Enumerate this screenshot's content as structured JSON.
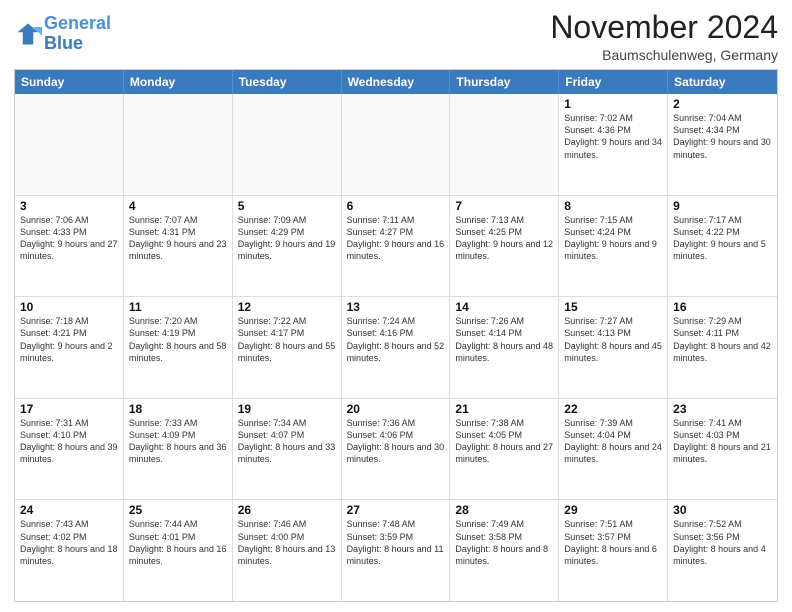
{
  "header": {
    "logo_general": "General",
    "logo_blue": "Blue",
    "month_title": "November 2024",
    "location": "Baumschulenweg, Germany"
  },
  "days_of_week": [
    "Sunday",
    "Monday",
    "Tuesday",
    "Wednesday",
    "Thursday",
    "Friday",
    "Saturday"
  ],
  "weeks": [
    {
      "cells": [
        {
          "day": "",
          "info": "",
          "empty": true
        },
        {
          "day": "",
          "info": "",
          "empty": true
        },
        {
          "day": "",
          "info": "",
          "empty": true
        },
        {
          "day": "",
          "info": "",
          "empty": true
        },
        {
          "day": "",
          "info": "",
          "empty": true
        },
        {
          "day": "1",
          "info": "Sunrise: 7:02 AM\nSunset: 4:36 PM\nDaylight: 9 hours and 34 minutes.",
          "empty": false
        },
        {
          "day": "2",
          "info": "Sunrise: 7:04 AM\nSunset: 4:34 PM\nDaylight: 9 hours and 30 minutes.",
          "empty": false
        }
      ]
    },
    {
      "cells": [
        {
          "day": "3",
          "info": "Sunrise: 7:06 AM\nSunset: 4:33 PM\nDaylight: 9 hours and 27 minutes.",
          "empty": false
        },
        {
          "day": "4",
          "info": "Sunrise: 7:07 AM\nSunset: 4:31 PM\nDaylight: 9 hours and 23 minutes.",
          "empty": false
        },
        {
          "day": "5",
          "info": "Sunrise: 7:09 AM\nSunset: 4:29 PM\nDaylight: 9 hours and 19 minutes.",
          "empty": false
        },
        {
          "day": "6",
          "info": "Sunrise: 7:11 AM\nSunset: 4:27 PM\nDaylight: 9 hours and 16 minutes.",
          "empty": false
        },
        {
          "day": "7",
          "info": "Sunrise: 7:13 AM\nSunset: 4:25 PM\nDaylight: 9 hours and 12 minutes.",
          "empty": false
        },
        {
          "day": "8",
          "info": "Sunrise: 7:15 AM\nSunset: 4:24 PM\nDaylight: 9 hours and 9 minutes.",
          "empty": false
        },
        {
          "day": "9",
          "info": "Sunrise: 7:17 AM\nSunset: 4:22 PM\nDaylight: 9 hours and 5 minutes.",
          "empty": false
        }
      ]
    },
    {
      "cells": [
        {
          "day": "10",
          "info": "Sunrise: 7:18 AM\nSunset: 4:21 PM\nDaylight: 9 hours and 2 minutes.",
          "empty": false
        },
        {
          "day": "11",
          "info": "Sunrise: 7:20 AM\nSunset: 4:19 PM\nDaylight: 8 hours and 58 minutes.",
          "empty": false
        },
        {
          "day": "12",
          "info": "Sunrise: 7:22 AM\nSunset: 4:17 PM\nDaylight: 8 hours and 55 minutes.",
          "empty": false
        },
        {
          "day": "13",
          "info": "Sunrise: 7:24 AM\nSunset: 4:16 PM\nDaylight: 8 hours and 52 minutes.",
          "empty": false
        },
        {
          "day": "14",
          "info": "Sunrise: 7:26 AM\nSunset: 4:14 PM\nDaylight: 8 hours and 48 minutes.",
          "empty": false
        },
        {
          "day": "15",
          "info": "Sunrise: 7:27 AM\nSunset: 4:13 PM\nDaylight: 8 hours and 45 minutes.",
          "empty": false
        },
        {
          "day": "16",
          "info": "Sunrise: 7:29 AM\nSunset: 4:11 PM\nDaylight: 8 hours and 42 minutes.",
          "empty": false
        }
      ]
    },
    {
      "cells": [
        {
          "day": "17",
          "info": "Sunrise: 7:31 AM\nSunset: 4:10 PM\nDaylight: 8 hours and 39 minutes.",
          "empty": false
        },
        {
          "day": "18",
          "info": "Sunrise: 7:33 AM\nSunset: 4:09 PM\nDaylight: 8 hours and 36 minutes.",
          "empty": false
        },
        {
          "day": "19",
          "info": "Sunrise: 7:34 AM\nSunset: 4:07 PM\nDaylight: 8 hours and 33 minutes.",
          "empty": false
        },
        {
          "day": "20",
          "info": "Sunrise: 7:36 AM\nSunset: 4:06 PM\nDaylight: 8 hours and 30 minutes.",
          "empty": false
        },
        {
          "day": "21",
          "info": "Sunrise: 7:38 AM\nSunset: 4:05 PM\nDaylight: 8 hours and 27 minutes.",
          "empty": false
        },
        {
          "day": "22",
          "info": "Sunrise: 7:39 AM\nSunset: 4:04 PM\nDaylight: 8 hours and 24 minutes.",
          "empty": false
        },
        {
          "day": "23",
          "info": "Sunrise: 7:41 AM\nSunset: 4:03 PM\nDaylight: 8 hours and 21 minutes.",
          "empty": false
        }
      ]
    },
    {
      "cells": [
        {
          "day": "24",
          "info": "Sunrise: 7:43 AM\nSunset: 4:02 PM\nDaylight: 8 hours and 18 minutes.",
          "empty": false
        },
        {
          "day": "25",
          "info": "Sunrise: 7:44 AM\nSunset: 4:01 PM\nDaylight: 8 hours and 16 minutes.",
          "empty": false
        },
        {
          "day": "26",
          "info": "Sunrise: 7:46 AM\nSunset: 4:00 PM\nDaylight: 8 hours and 13 minutes.",
          "empty": false
        },
        {
          "day": "27",
          "info": "Sunrise: 7:48 AM\nSunset: 3:59 PM\nDaylight: 8 hours and 11 minutes.",
          "empty": false
        },
        {
          "day": "28",
          "info": "Sunrise: 7:49 AM\nSunset: 3:58 PM\nDaylight: 8 hours and 8 minutes.",
          "empty": false
        },
        {
          "day": "29",
          "info": "Sunrise: 7:51 AM\nSunset: 3:57 PM\nDaylight: 8 hours and 6 minutes.",
          "empty": false
        },
        {
          "day": "30",
          "info": "Sunrise: 7:52 AM\nSunset: 3:56 PM\nDaylight: 8 hours and 4 minutes.",
          "empty": false
        }
      ]
    }
  ]
}
